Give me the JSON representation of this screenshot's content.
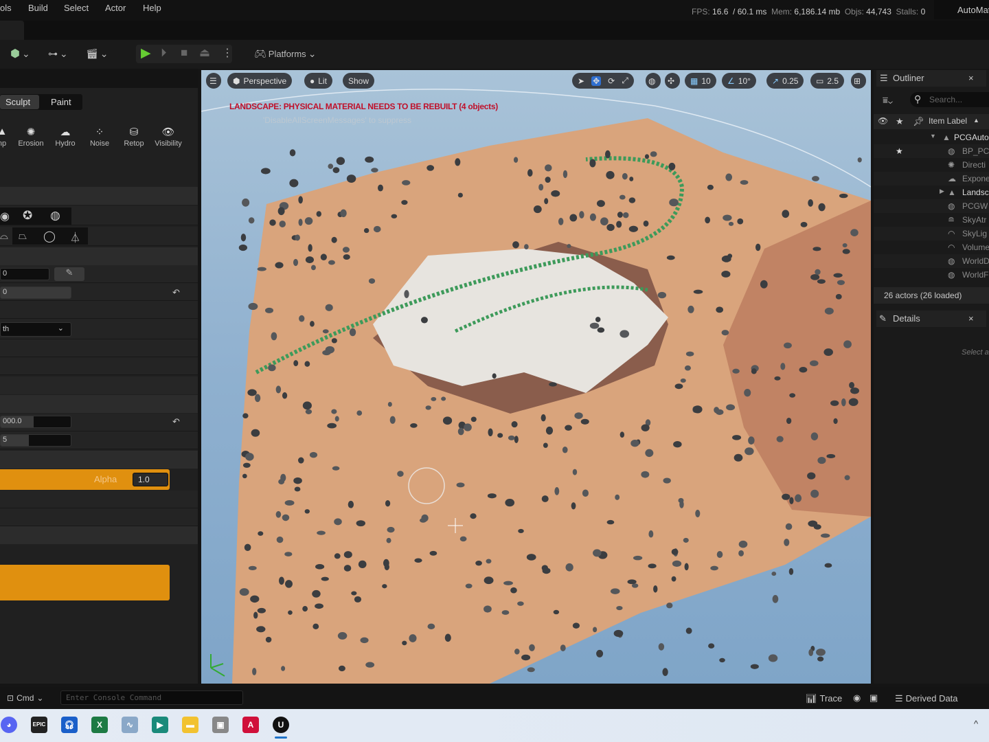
{
  "menu": [
    "ols",
    "Build",
    "Select",
    "Actor",
    "Help"
  ],
  "stats": {
    "fps_label": "FPS:",
    "fps": "16.6",
    "ms": "/ 60.1 ms",
    "mem_label": "Mem:",
    "mem": "6,186.14 mb",
    "objs_label": "Objs:",
    "objs": "44,743",
    "stalls_label": "Stalls:",
    "stalls": "0"
  },
  "project": "AutoMat",
  "toolbar": {
    "platforms": "Platforms"
  },
  "left": {
    "modes": [
      "Sculpt",
      "Paint"
    ],
    "tools": [
      {
        "label": "np",
        "icon": "ramp-icon"
      },
      {
        "label": "Erosion",
        "icon": "erosion-icon"
      },
      {
        "label": "Hydro",
        "icon": "hydro-icon"
      },
      {
        "label": "Noise",
        "icon": "noise-icon"
      },
      {
        "label": "Retop",
        "icon": "retop-icon"
      },
      {
        "label": "Visibility",
        "icon": "visibility-icon"
      }
    ],
    "field1": "0",
    "field2": "0",
    "dropdown": "th",
    "field3": "000.0",
    "field4": "5",
    "alpha_label": "Alpha",
    "alpha": "1.0"
  },
  "viewport": {
    "menu": "Perspective",
    "lit": "Lit",
    "show": "Show",
    "grid": "10",
    "angle": "10°",
    "scale": "0.25",
    "camera": "2.5",
    "warning": "LANDSCAPE: PHYSICAL MATERIAL NEEDS TO BE REBUILT (4 objects)",
    "suppress": "'DisableAllScreenMessages' to suppress",
    "warning_color": "#c0102a"
  },
  "outliner": {
    "title": "Outliner",
    "search_placeholder": "Search...",
    "column": "Item Label",
    "items": [
      "PCGAuto",
      "BP_PC",
      "Directi",
      "Expone",
      "Landsc",
      "PCGW",
      "SkyAtr",
      "SkyLig",
      "Volume",
      "WorldD",
      "WorldF"
    ],
    "footer": "26 actors (26 loaded)"
  },
  "details": {
    "title": "Details",
    "hint": "Select a"
  },
  "status": {
    "cmd": "Cmd",
    "console_placeholder": "Enter Console Command",
    "trace": "Trace",
    "derived": "Derived Data"
  },
  "taskbar": [
    "discord",
    "epic-games",
    "audacity",
    "excel",
    "perf-monitor",
    "filmora",
    "file-explorer",
    "device-app",
    "amd",
    "unreal"
  ],
  "accent": "#e0900f"
}
